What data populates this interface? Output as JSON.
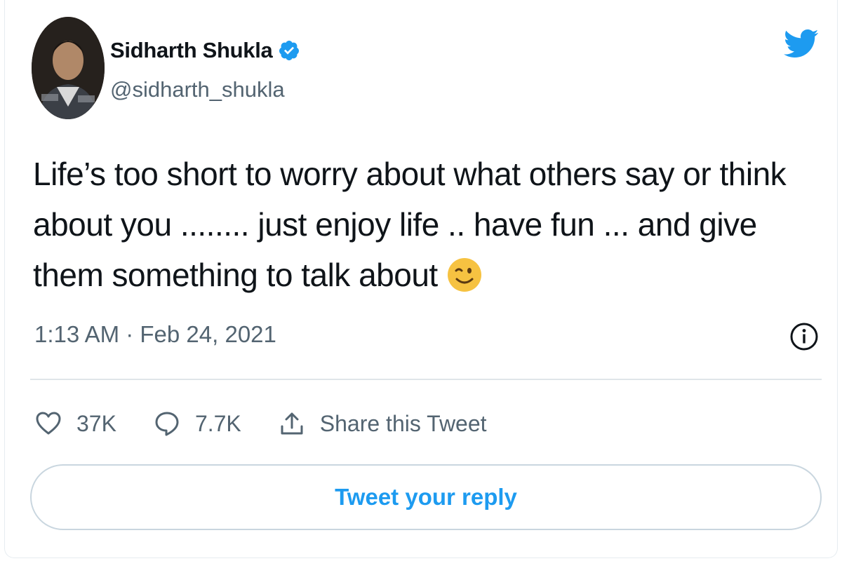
{
  "author": {
    "name": "Sidharth Shukla",
    "handle": "@sidharth_shukla",
    "verified": true
  },
  "tweet": {
    "text": "Life’s too short to worry about what others say or think about you ........ just enjoy life .. have fun ... and give them something to talk about",
    "emoji": "winking-face",
    "timestamp": "1:13 AM · Feb 24, 2021"
  },
  "actions": {
    "likes": "37K",
    "replies": "7.7K",
    "share_label": "Share this Tweet"
  },
  "reply_button": {
    "label": "Tweet your reply"
  },
  "icons": {
    "brand": "twitter-bird-icon",
    "verified": "verified-badge-icon",
    "info": "info-icon",
    "like": "heart-icon",
    "reply": "speech-bubble-icon",
    "share": "share-upload-icon"
  },
  "colors": {
    "accent": "#1d9bf0",
    "text": "#0f1419",
    "muted": "#536471",
    "emoji": "#f6c241"
  }
}
